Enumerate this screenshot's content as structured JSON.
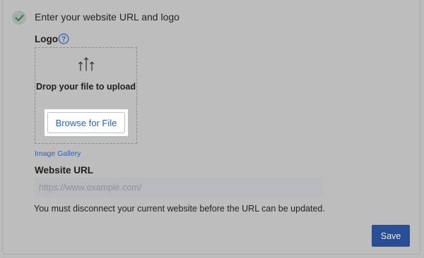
{
  "step": {
    "title": "Enter your website URL and logo",
    "status_icon": "checkmark-icon"
  },
  "logo": {
    "label": "Logo",
    "help_icon": "question-circle-icon",
    "upload_icon": "upload-arrows-icon",
    "drop_text": "Drop your file to upload",
    "browse_label": "Browse for File",
    "gallery_link": "Image Gallery"
  },
  "website": {
    "label": "Website URL",
    "placeholder": "https://www.example.com/",
    "value": "",
    "note": "You must disconnect your current website before the URL can be updated."
  },
  "actions": {
    "save_label": "Save"
  },
  "colors": {
    "overlay": "#bcbcbc",
    "link": "#3261a8",
    "primary_button": "#2a4e96",
    "browse_text": "#2a63c7"
  }
}
